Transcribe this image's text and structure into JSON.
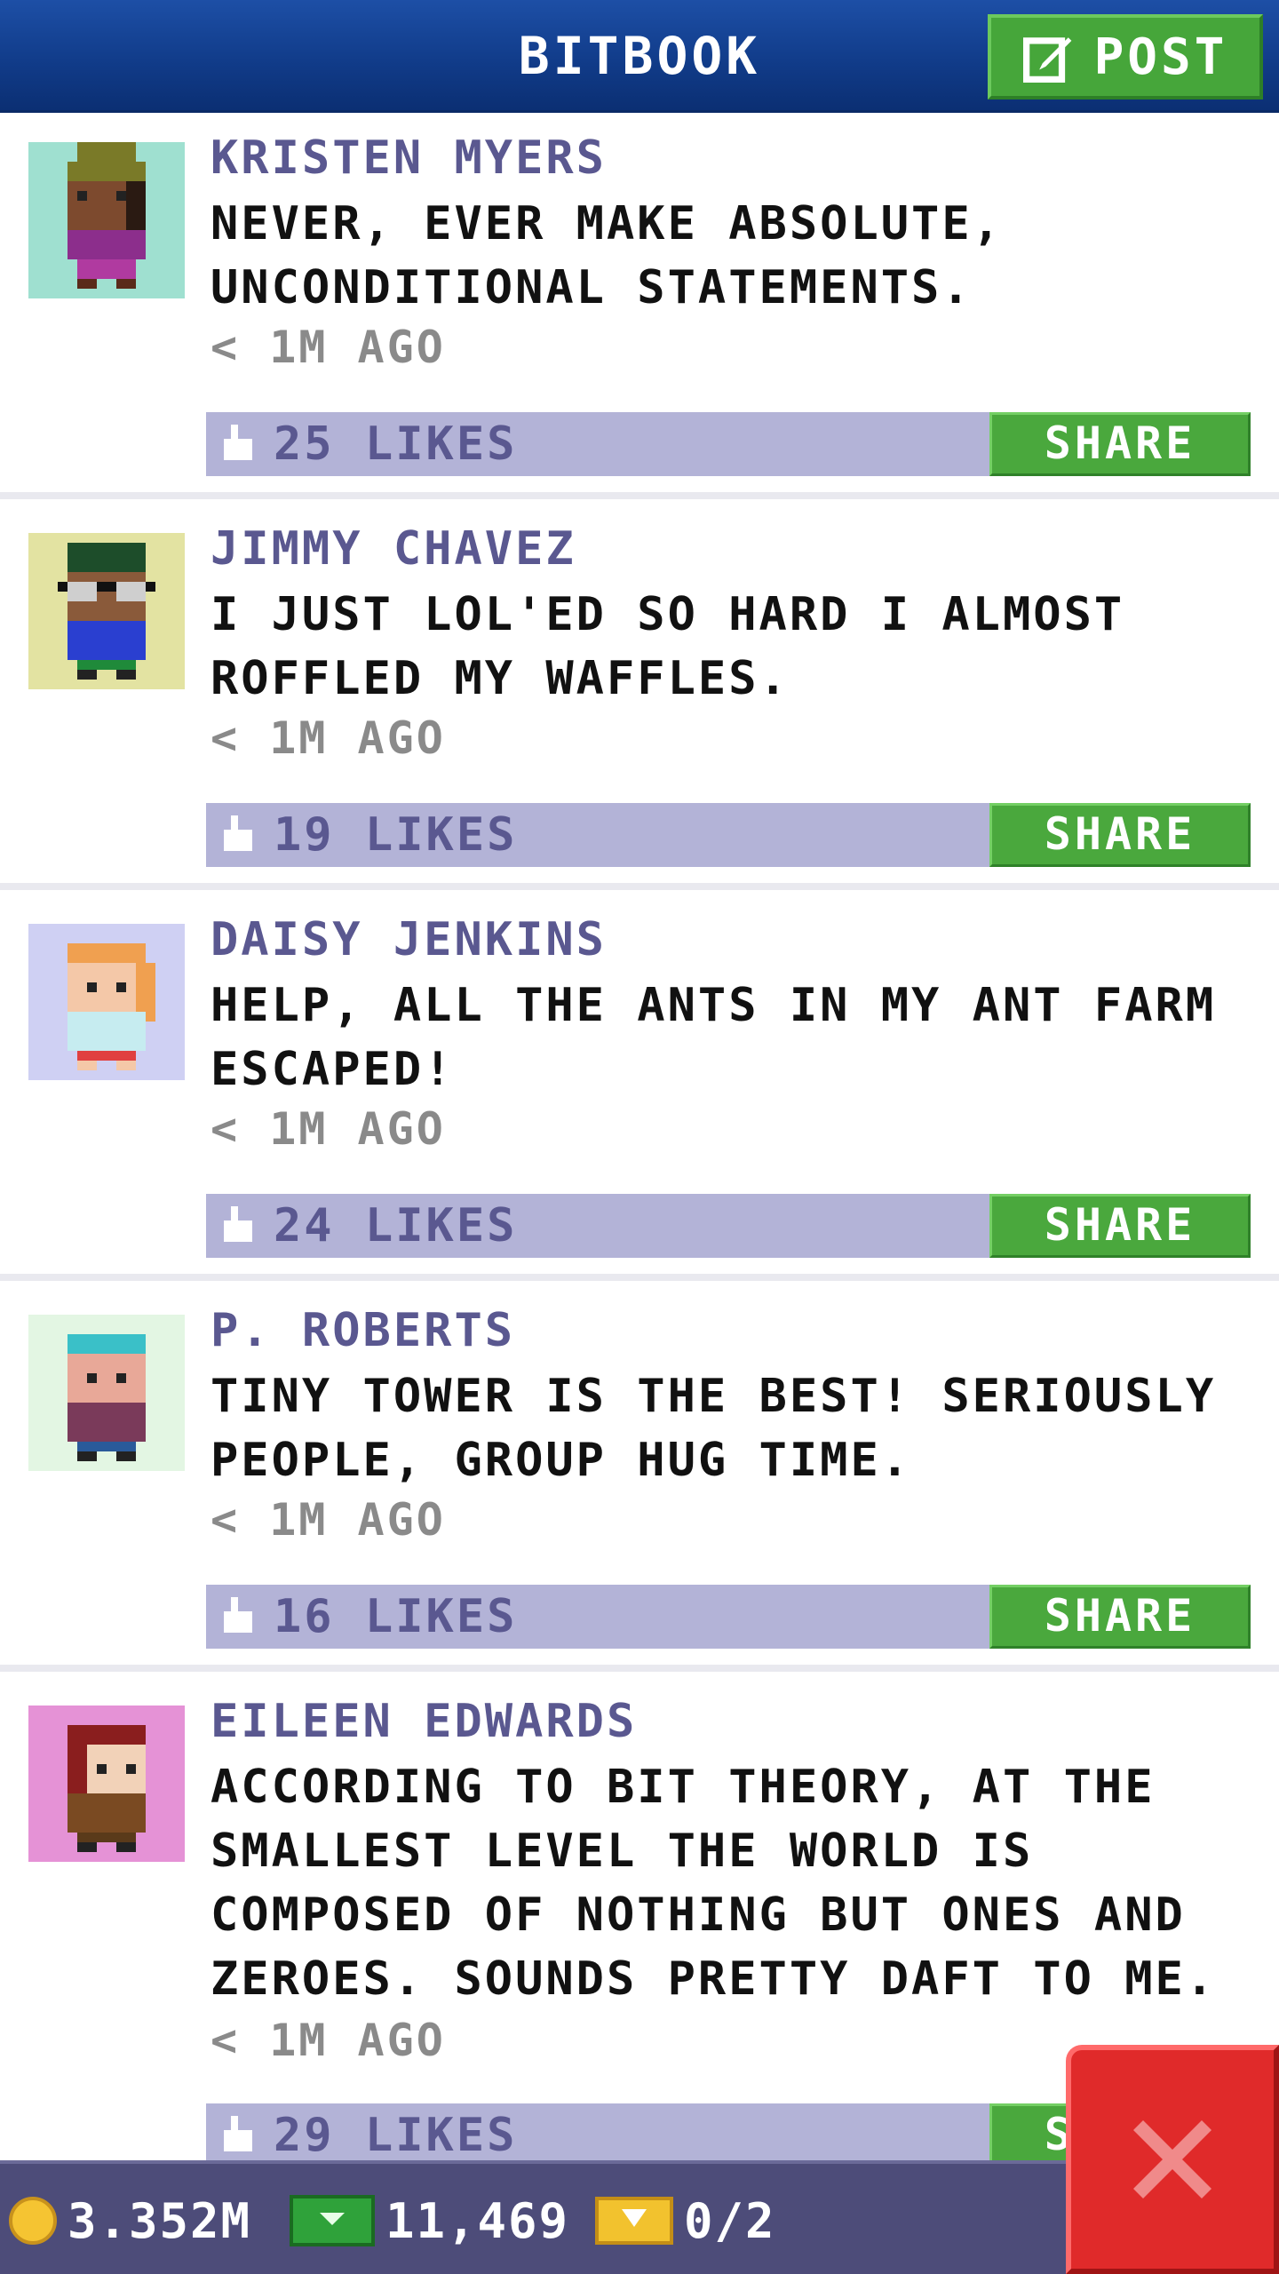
{
  "header": {
    "title": "BITBOOK",
    "post_label": "POST"
  },
  "posts": [
    {
      "name": "KRISTEN MYERS",
      "message": "NEVER, EVER MAKE ABSOLUTE, UNCONDITIONAL STATEMENTS.",
      "time": "< 1M AGO",
      "likes": "25 LIKES",
      "share_label": "SHARE",
      "avatar_bg": "#9fe0d0"
    },
    {
      "name": "JIMMY CHAVEZ",
      "message": "I JUST LOL'ED SO HARD I ALMOST ROFFLED MY WAFFLES.",
      "time": "< 1M AGO",
      "likes": "19 LIKES",
      "share_label": "SHARE",
      "avatar_bg": "#e3e3a2"
    },
    {
      "name": "DAISY JENKINS",
      "message": "HELP, ALL THE ANTS IN MY ANT FARM ESCAPED!",
      "time": "< 1M AGO",
      "likes": "24 LIKES",
      "share_label": "SHARE",
      "avatar_bg": "#cfd0f3"
    },
    {
      "name": "P. ROBERTS",
      "message": "TINY TOWER IS THE BEST! SERIOUSLY PEOPLE, GROUP HUG TIME.",
      "time": "< 1M AGO",
      "likes": "16 LIKES",
      "share_label": "SHARE",
      "avatar_bg": "#e3f6e3"
    },
    {
      "name": "EILEEN EDWARDS",
      "message": "ACCORDING TO BIT THEORY, AT THE SMALLEST LEVEL THE WORLD IS COMPOSED OF NOTHING BUT ONES AND ZEROES. SOUNDS PRETTY DAFT TO ME.",
      "time": "< 1M AGO",
      "likes": "29 LIKES",
      "share_label": "SHARE",
      "avatar_bg": "#e592d6"
    }
  ],
  "status_bar": {
    "coins": "3.352M",
    "bux": "11,469",
    "tickets": "0/2"
  },
  "colors": {
    "header": "#113c8a",
    "accent_green": "#46a63a",
    "like_bar": "#b3b3d7",
    "name_purple": "#5a5890",
    "close_red": "#e02a2a"
  },
  "icons": {
    "post": "edit-icon",
    "like": "thumbs-up-icon",
    "close": "close-icon",
    "coins": "coin-icon",
    "bux": "bux-icon",
    "tickets": "ticket-icon"
  }
}
